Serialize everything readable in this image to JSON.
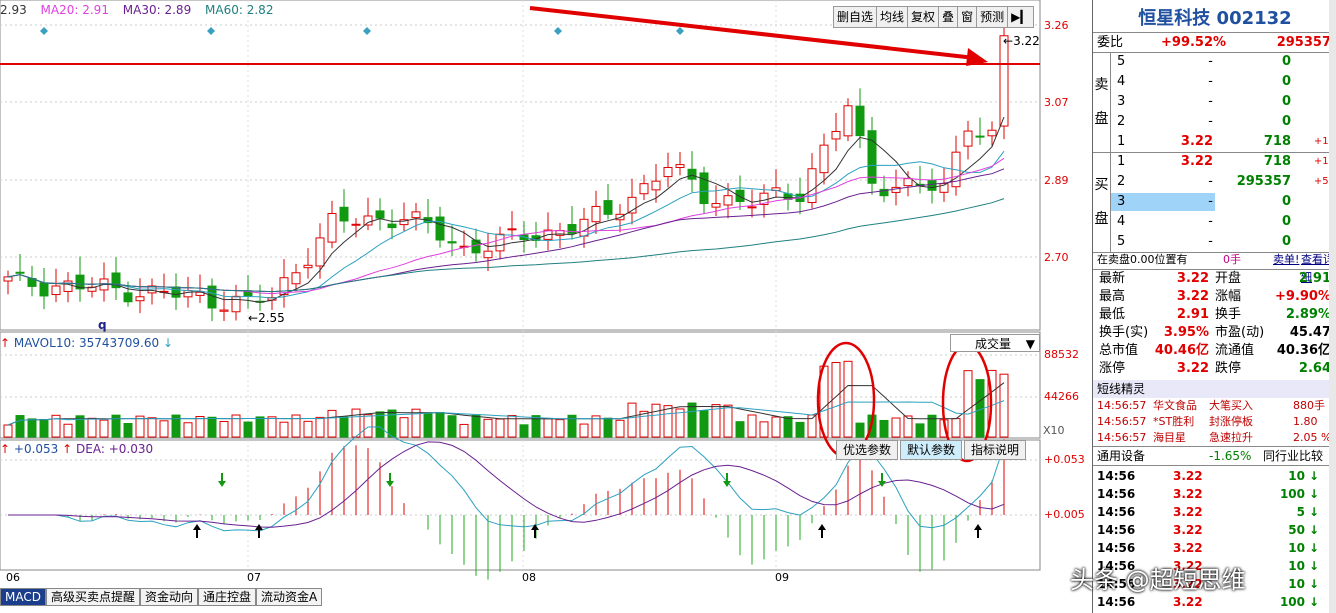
{
  "ma_legend": {
    "ma5": "2.93",
    "ma20": "MA20: 2.91",
    "ma30": "MA30: 2.89",
    "ma60": "MA60: 2.82"
  },
  "toolbar": [
    "删自选",
    "均线",
    "复权",
    "叠",
    "窗",
    "预测"
  ],
  "price_axis": [
    "3.26",
    "3.07",
    "2.89",
    "2.70"
  ],
  "high_label": "3.22",
  "low_label": "2.55",
  "q_label": "q",
  "vol_legend": "MAVOL10: 35743709.60",
  "vol_axis": [
    "88532",
    "44266"
  ],
  "vol_dropdown": "成交量",
  "x10_label": "X10",
  "macd_legend": {
    "dif": "+0.053",
    "dea": "DEA: +0.030"
  },
  "macd_axis": [
    "+0.053",
    "+0.005"
  ],
  "param_buttons": [
    "优选参数",
    "默认参数",
    "指标说明"
  ],
  "months": [
    "06",
    "07",
    "08",
    "09"
  ],
  "bottom_tabs": [
    "MACD",
    "高级买卖点提醒",
    "资金动向",
    "通庄控盘",
    "流动资金A"
  ],
  "right": {
    "title": "恒星科技 002132",
    "weibi_label": "委比",
    "weibi_pct": "+99.52%",
    "weibi_vol": "295357",
    "sell_label": [
      "卖",
      "盘"
    ],
    "buy_label": [
      "买",
      "盘"
    ],
    "sell": [
      {
        "lvl": "5",
        "price": "-",
        "vol": "0",
        "chg": ""
      },
      {
        "lvl": "4",
        "price": "-",
        "vol": "0",
        "chg": ""
      },
      {
        "lvl": "3",
        "price": "-",
        "vol": "0",
        "chg": ""
      },
      {
        "lvl": "2",
        "price": "-",
        "vol": "0",
        "chg": ""
      },
      {
        "lvl": "1",
        "price": "3.22",
        "vol": "718",
        "chg": "+10"
      }
    ],
    "buy": [
      {
        "lvl": "1",
        "price": "3.22",
        "vol": "718",
        "chg": "+10"
      },
      {
        "lvl": "2",
        "price": "-",
        "vol": "295357",
        "chg": "+57"
      },
      {
        "lvl": "3",
        "price": "-",
        "vol": "0",
        "chg": ""
      },
      {
        "lvl": "4",
        "price": "-",
        "vol": "0",
        "chg": ""
      },
      {
        "lvl": "5",
        "price": "-",
        "vol": "0",
        "chg": ""
      }
    ],
    "info_bar": {
      "text": "在卖盘0.00位置有",
      "vol": "0手",
      "link1": "卖单!",
      "link2": "查看详细"
    },
    "stats": [
      {
        "l1": "最新",
        "v1": "3.22",
        "l2": "开盘",
        "v2": "2.91"
      },
      {
        "l1": "最高",
        "v1": "3.22",
        "l2": "涨幅",
        "v2": "+9.90%"
      },
      {
        "l1": "最低",
        "v1": "2.91",
        "l2": "换手",
        "v2": "2.89%"
      },
      {
        "l1": "换手(实)",
        "v1": "3.95%",
        "l2": "市盈(动)",
        "v2": "45.47"
      },
      {
        "l1": "总市值",
        "v1": "40.46亿",
        "l2": "流通值",
        "v2": "40.36亿"
      },
      {
        "l1": "涨停",
        "v1": "3.22",
        "l2": "跌停",
        "v2": "2.64"
      }
    ],
    "short_head": "短线精灵",
    "news": [
      {
        "time": "14:56:57",
        "name": "华文食品",
        "act": "大笔买入",
        "val": "880手"
      },
      {
        "time": "14:56:57",
        "name": "*ST胜利",
        "act": "封涨停板",
        "val": "1.80"
      },
      {
        "time": "14:56:57",
        "name": "海目星",
        "act": "急速拉升",
        "val": "2.05 %"
      }
    ],
    "sector": {
      "name": "通用设备",
      "pct": "-1.65%",
      "link": "同行业比较"
    },
    "ticks": [
      {
        "time": "14:56",
        "price": "3.22",
        "vol": "10"
      },
      {
        "time": "14:56",
        "price": "3.22",
        "vol": "100"
      },
      {
        "time": "14:56",
        "price": "3.22",
        "vol": "5"
      },
      {
        "time": "14:56",
        "price": "3.22",
        "vol": "50"
      },
      {
        "time": "14:56",
        "price": "3.22",
        "vol": "10"
      },
      {
        "time": "14:56",
        "price": "3.22",
        "vol": "10"
      },
      {
        "time": "14:56",
        "price": "3.22",
        "vol": "10"
      },
      {
        "time": "14:56",
        "price": "3.22",
        "vol": "100"
      }
    ]
  },
  "watermark": "头条 @超短思维",
  "colors": {
    "up": "#e00000",
    "down": "#119911",
    "ma5": "#333333",
    "ma10": "#2ba0c0",
    "ma20": "#e040e0",
    "ma30": "#6a2090",
    "ma60": "#208080",
    "accent_line": "#e00000"
  }
}
